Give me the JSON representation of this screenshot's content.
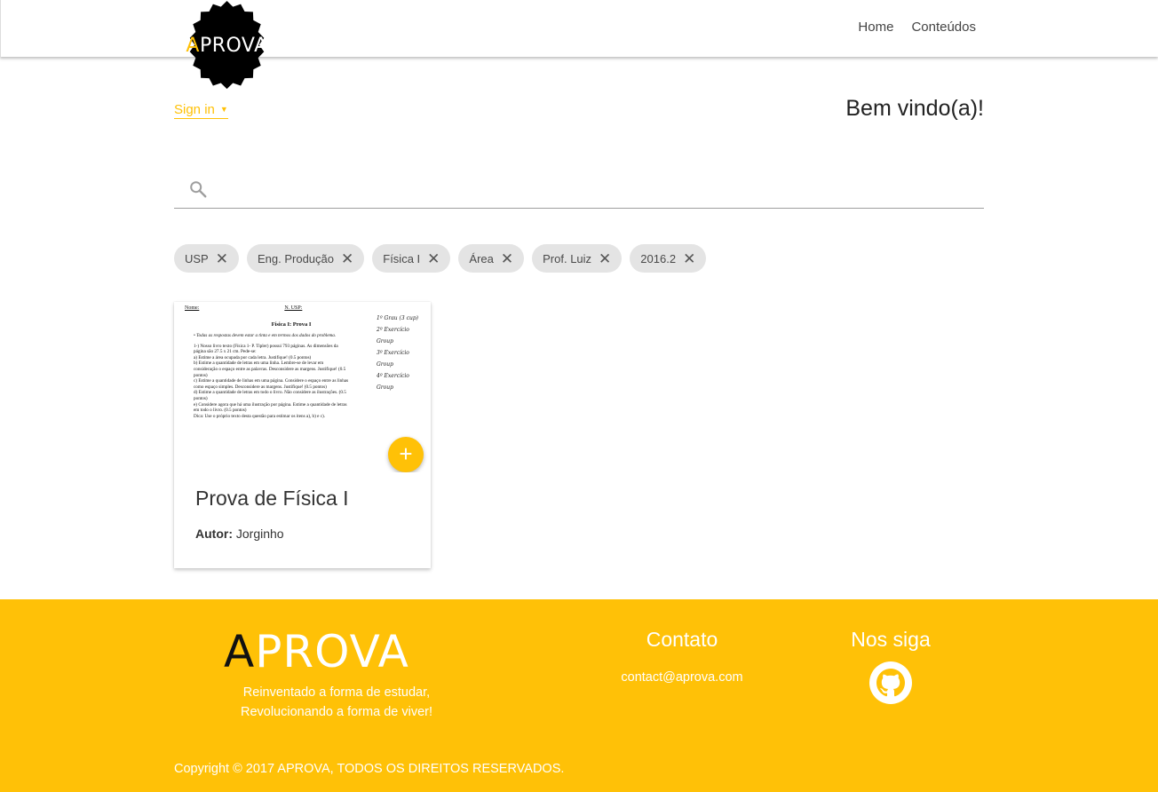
{
  "header": {
    "logo_text": "APROVA",
    "nav": [
      "Home",
      "Conteúdos"
    ]
  },
  "page": {
    "signin_label": "Sign in",
    "welcome": "Bem vindo(a)!",
    "search": {
      "value": "",
      "placeholder": ""
    },
    "chips": [
      "USP",
      "Eng. Produção",
      "Física I",
      "Área",
      "Prof. Luiz",
      "2016.2"
    ]
  },
  "card": {
    "title": "Prova de Física I",
    "author_label": "Autor:",
    "author": "Jorginho",
    "fab_label": "+",
    "preview": {
      "name_label": "Nome:",
      "nusp_label": "N. USP:",
      "doc_title": "Física I: Prova I",
      "bullet": "• Todas as respostas devem estar a tinta e em termos dos dados do problema.",
      "lines": [
        "1-) Nosso livro texto (Física 1- P. Tipler) possui 793 páginas. As dimensões da",
        "página são 27.5 x 21 cm. Pede-se:",
        "a) Estime a área ocupada por cada letra. Justifique! (0.5 pontos)",
        "b) Estime a quantidade de letras em uma linha. Lembre-se de levar em",
        "consideração o espaço entre as palavras. Desconsidere as margens. Justifique! (0.5",
        "pontos)",
        "c) Estime a quantidade de linhas em uma página. Considere o espaço entre as linhas",
        "como espaço simples. Desconsidere as margens. Justifique! (0.5 pontos)",
        "d) Estime a quantidade de letras em todo o livro. Não considere as ilustrações. (0.5",
        "pontos)",
        "e) Considere agora que há uma ilustração por página. Estime a quantidade de letras",
        "em todo o livro. (0.5 pontos)",
        "Dica: Use o próprio texto desta questão para estimar os itens a), b) e c)."
      ],
      "handwritten": [
        "1º Grau (3 cup)",
        "2º Exercício Group",
        "3º Exercício Group",
        "4º Exercício Group"
      ]
    }
  },
  "footer": {
    "logo_text": "APROVA",
    "tagline": [
      "Reinventado a forma de estudar,",
      "Revolucionando a forma de viver!"
    ],
    "contato_title": "Contato",
    "email": "contact@aprova.com",
    "siga_title": "Nos siga",
    "copyright": "Copyright © 2017 APROVA, TODOS OS DIREITOS RESERVADOS."
  },
  "colors": {
    "accent": "#FFC107",
    "logo_badge": "#000000"
  }
}
